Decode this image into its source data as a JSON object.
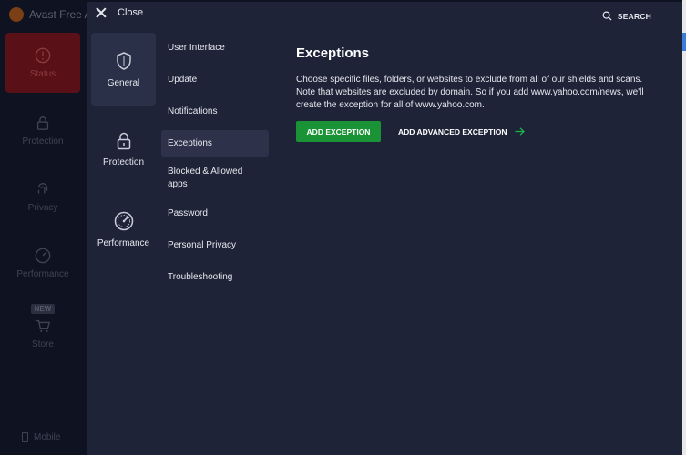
{
  "background_app": {
    "title": "Avast Free A",
    "nav": [
      {
        "label": "Status",
        "icon": "alert-circle-icon",
        "active": true
      },
      {
        "label": "Protection",
        "icon": "lock-icon"
      },
      {
        "label": "Privacy",
        "icon": "fingerprint-icon"
      },
      {
        "label": "Performance",
        "icon": "gauge-icon"
      },
      {
        "label": "Store",
        "icon": "cart-icon",
        "badge": "NEW"
      }
    ],
    "mobile_label": "Mobile"
  },
  "header": {
    "close_label": "Close",
    "search_label": "SEARCH"
  },
  "categories": [
    {
      "label": "General",
      "icon": "shield-icon",
      "active": true
    },
    {
      "label": "Protection",
      "icon": "lock-icon"
    },
    {
      "label": "Performance",
      "icon": "speedometer-icon"
    }
  ],
  "subitems": [
    {
      "label": "User Interface"
    },
    {
      "label": "Update"
    },
    {
      "label": "Notifications"
    },
    {
      "label": "Exceptions",
      "active": true
    },
    {
      "label": "Blocked & Allowed apps"
    },
    {
      "label": "Password"
    },
    {
      "label": "Personal Privacy"
    },
    {
      "label": "Troubleshooting"
    }
  ],
  "main": {
    "title": "Exceptions",
    "description": "Choose specific files, folders, or websites to exclude from all of our shields and scans. Note that websites are excluded by domain. So if you add www.yahoo.com/news, we'll create the exception for all of www.yahoo.com.",
    "add_exception_label": "ADD EXCEPTION",
    "add_advanced_label": "ADD ADVANCED EXCEPTION"
  },
  "colors": {
    "panel_bg": "#1f2337",
    "active_item_bg": "#2d324a",
    "primary_button": "#1a9337",
    "accent_arrow": "#1ab34a"
  }
}
